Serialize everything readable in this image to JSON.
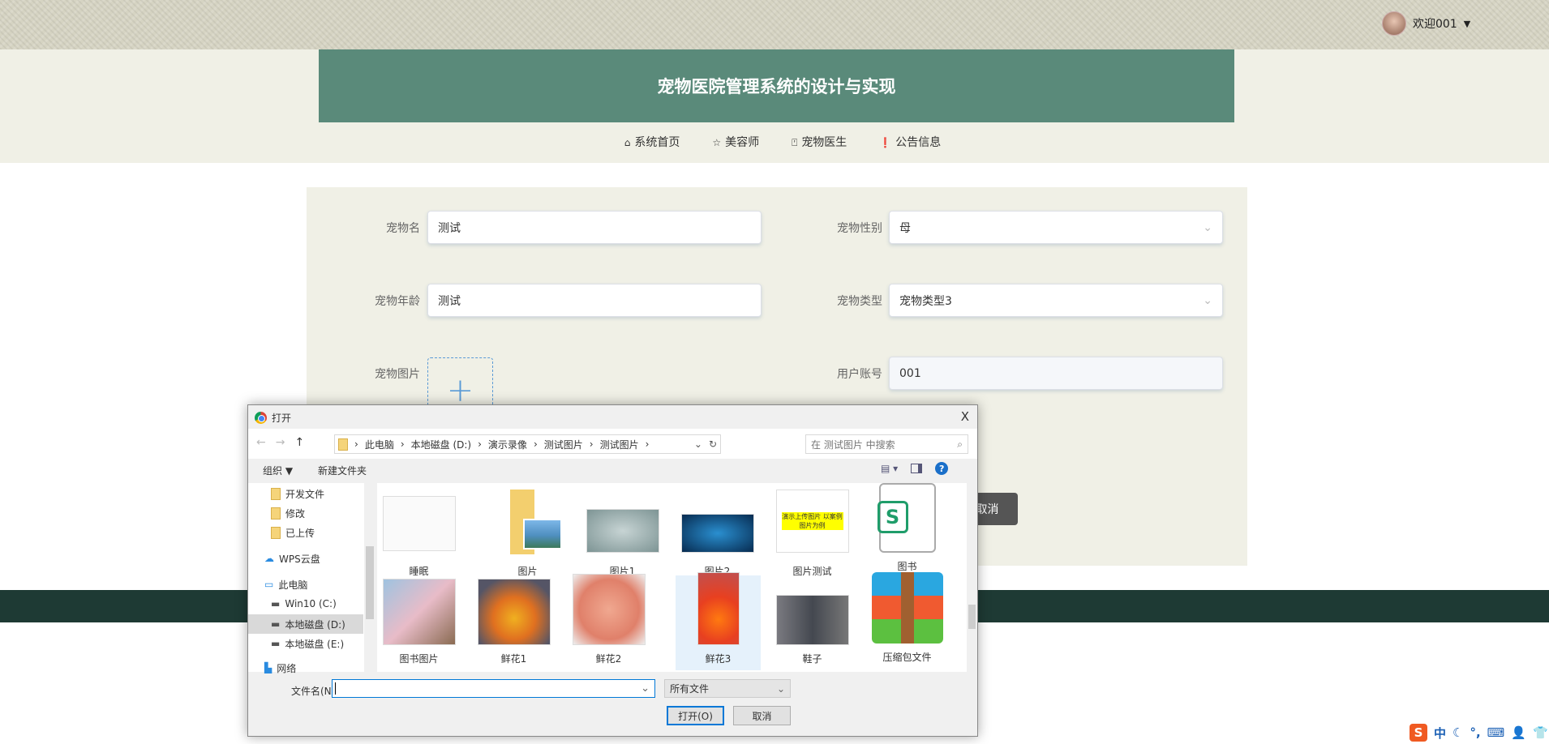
{
  "user": {
    "greeting": "欢迎001",
    "dropdown": "▼"
  },
  "header": {
    "title": "宠物医院管理系统的设计与实现"
  },
  "nav": [
    {
      "icon": "home-icon",
      "glyph": "⌂",
      "label": "系统首页"
    },
    {
      "icon": "star-icon",
      "glyph": "☆",
      "label": "美容师"
    },
    {
      "icon": "bag-icon",
      "glyph": "⍞",
      "label": "宠物医生"
    },
    {
      "icon": "info-icon",
      "glyph": "❗",
      "label": "公告信息"
    }
  ],
  "form": {
    "pet_name": {
      "label": "宠物名",
      "value": "测试"
    },
    "pet_sex": {
      "label": "宠物性别",
      "value": "母"
    },
    "pet_age": {
      "label": "宠物年龄",
      "value": "测试"
    },
    "pet_type": {
      "label": "宠物类型",
      "value": "宠物类型3"
    },
    "pet_image": {
      "label": "宠物图片",
      "plus": "+"
    },
    "account": {
      "label": "用户账号",
      "value": "001"
    },
    "cancel": "取消"
  },
  "dialog": {
    "title": "打开",
    "close": "X",
    "breadcrumb": [
      "此电脑",
      "本地磁盘 (D:)",
      "演示录像",
      "测试图片",
      "测试图片"
    ],
    "search_placeholder": "在 测试图片 中搜索",
    "organize": "组织 ▼",
    "new_folder": "新建文件夹",
    "sidebar": [
      "开发文件",
      "修改",
      "已上传",
      "WPS云盘",
      "此电脑",
      "Win10 (C:)",
      "本地磁盘 (D:)",
      "本地磁盘 (E:)",
      "网络"
    ],
    "files": [
      "睡眠",
      "图片",
      "图片1",
      "图片2",
      "图片测试",
      "图书",
      "图书图片",
      "鲜花1",
      "鲜花2",
      "鲜花3",
      "鞋子",
      "压缩包文件"
    ],
    "thumb_text": "演示上传图片 以案例图片为例",
    "filename_label": "文件名(N):",
    "filename_value": "",
    "filter": "所有文件",
    "open": "打开(O)",
    "cancel": "取消"
  },
  "ime": {
    "logo": "S",
    "mode": "中"
  }
}
